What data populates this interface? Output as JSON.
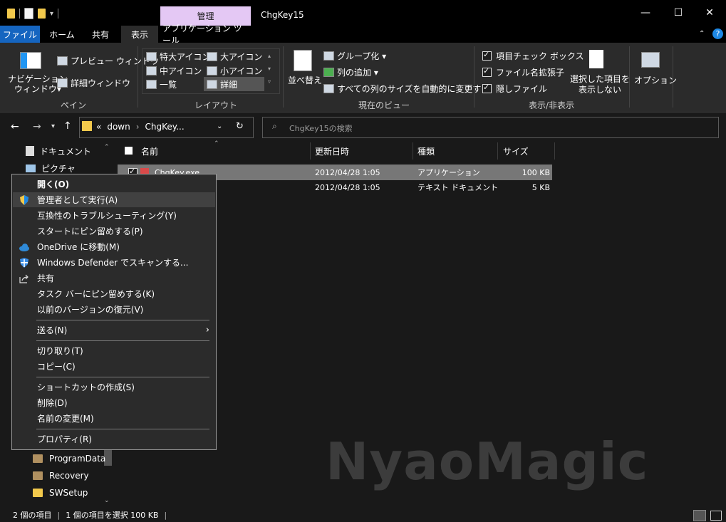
{
  "title_bar": {
    "context_tab_header": "管理",
    "window_title": "ChgKey15",
    "minimize": "—",
    "maximize": "☐",
    "close": "✕"
  },
  "tabs": [
    {
      "label": "ファイル",
      "active": true
    },
    {
      "label": "ホーム"
    },
    {
      "label": "共有"
    },
    {
      "label": "表示",
      "selected": true
    },
    {
      "label": "アプリケーション ツール"
    }
  ],
  "ribbon": {
    "pane": {
      "nav_pane_line1": "ナビゲーション",
      "nav_pane_line2": "ウィンドウ▾",
      "preview": "プレビュー ウィンドウ",
      "details": "詳細ウィンドウ",
      "label": "ペイン"
    },
    "layout": {
      "items": [
        "特大アイコン",
        "大アイコン",
        "中アイコン",
        "小アイコン",
        "一覧",
        "詳細"
      ],
      "label": "レイアウト"
    },
    "current_view": {
      "sort": "並べ替え",
      "group": "グループ化 ▾",
      "add_column": "列の追加 ▾",
      "fit_columns": "すべての列のサイズを自動的に変更する",
      "label": "現在のビュー"
    },
    "show_hide": {
      "item_checkbox": "項目チェック ボックス",
      "extensions": "ファイル名拡張子",
      "hidden": "隠しファイル",
      "hide_selected_line1": "選択した項目を",
      "hide_selected_line2": "表示しない",
      "label": "表示/非表示"
    },
    "options": "オプション"
  },
  "address": {
    "prefix": "«",
    "parts": [
      "down",
      "ChgKey..."
    ],
    "search_placeholder": "ChgKey15の検索"
  },
  "columns": [
    "名前",
    "更新日時",
    "種類",
    "サイズ"
  ],
  "files": [
    {
      "name": "ChgKey.exe",
      "date": "2012/04/28 1:05",
      "type": "アプリケーション",
      "size": "100 KB",
      "selected": true
    },
    {
      "name": "",
      "date": "2012/04/28 1:05",
      "type": "テキスト ドキュメント",
      "size": "5 KB"
    }
  ],
  "nav_tree": {
    "top": [
      "ドキュメント",
      "ピクチャ"
    ],
    "bottom": [
      "ProgramData",
      "Recovery",
      "SWSetup"
    ]
  },
  "context_menu": [
    {
      "label": "開く(O)",
      "bold": true
    },
    {
      "label": "管理者として実行(A)",
      "icon": "shield-icon",
      "highlight": true
    },
    {
      "label": "互換性のトラブルシューティング(Y)"
    },
    {
      "label": "スタートにピン留めする(P)"
    },
    {
      "label": "OneDrive に移動(M)",
      "icon": "cloud-icon"
    },
    {
      "label": "Windows Defender でスキャンする...",
      "icon": "defender-icon"
    },
    {
      "label": "共有",
      "icon": "share-icon"
    },
    {
      "label": "タスク バーにピン留めする(K)"
    },
    {
      "label": "以前のバージョンの復元(V)"
    },
    {
      "label": "送る(N)",
      "submenu": true
    },
    {
      "label": "切り取り(T)"
    },
    {
      "label": "コピー(C)"
    },
    {
      "label": "ショートカットの作成(S)"
    },
    {
      "label": "削除(D)"
    },
    {
      "label": "名前の変更(M)"
    },
    {
      "label": "プロパティ(R)"
    }
  ],
  "status": {
    "count": "2 個の項目",
    "selected": "1 個の項目を選択  100 KB"
  },
  "watermark": "NyaoMagic",
  "colors": {
    "context_header": "#e4c8f4",
    "accent_blue": "#1565c0",
    "background": "#191919"
  }
}
